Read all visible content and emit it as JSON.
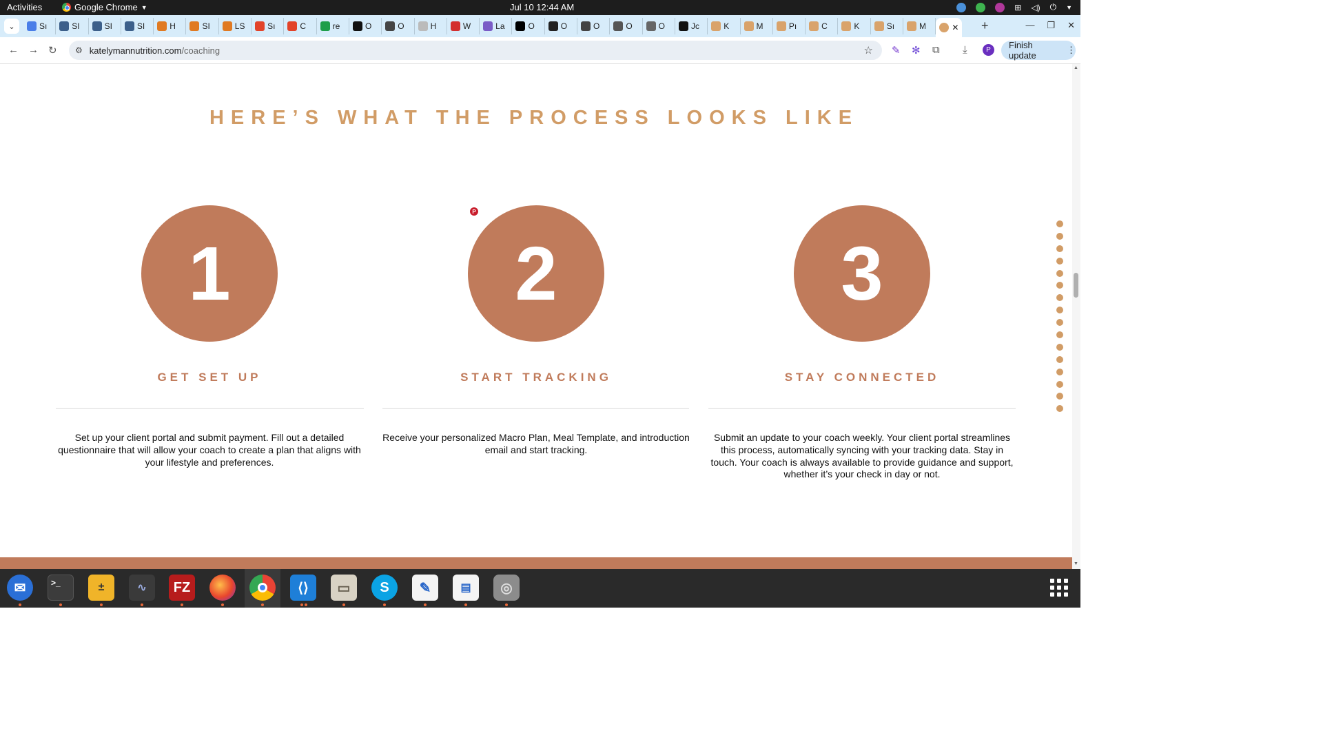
{
  "system_bar": {
    "activities": "Activities",
    "app_name": "Google Chrome",
    "clock": "Jul 10  12:44 AM"
  },
  "tabs": [
    {
      "label": "Sı",
      "color": "#4a7ee8"
    },
    {
      "label": "SI",
      "color": "#3c5f8a"
    },
    {
      "label": "SI",
      "color": "#3c5f8a"
    },
    {
      "label": "SI",
      "color": "#3c5f8a"
    },
    {
      "label": "H",
      "color": "#e07a22"
    },
    {
      "label": "SI",
      "color": "#e07a22"
    },
    {
      "label": "LS",
      "color": "#e07a22"
    },
    {
      "label": "Sı",
      "color": "#e24329"
    },
    {
      "label": "C",
      "color": "#e24329"
    },
    {
      "label": "re",
      "color": "#1e9e4a"
    },
    {
      "label": "O",
      "color": "#111111"
    },
    {
      "label": "O",
      "color": "#444444"
    },
    {
      "label": "H",
      "color": "#bbbbbb"
    },
    {
      "label": "W",
      "color": "#d32f2f"
    },
    {
      "label": "La",
      "color": "#7a5cc7"
    },
    {
      "label": "O",
      "color": "#000000"
    },
    {
      "label": "O",
      "color": "#222222"
    },
    {
      "label": "O",
      "color": "#444444"
    },
    {
      "label": "O",
      "color": "#555555"
    },
    {
      "label": "O",
      "color": "#666666"
    },
    {
      "label": "Jc",
      "color": "#111111"
    },
    {
      "label": "K",
      "color": "#d9a36b"
    },
    {
      "label": "M",
      "color": "#d9a36b"
    },
    {
      "label": "Pı",
      "color": "#d9a36b"
    },
    {
      "label": "C",
      "color": "#d9a36b"
    },
    {
      "label": "K",
      "color": "#d9a36b"
    },
    {
      "label": "Sı",
      "color": "#d9a36b"
    },
    {
      "label": "M",
      "color": "#d9a36b"
    }
  ],
  "active_tab": {
    "close": "✕",
    "color": "#d9a36b"
  },
  "address_bar": {
    "host": "katelymannutrition.com",
    "path": "/coaching",
    "profile_initial": "P",
    "finish_update": "Finish update"
  },
  "content": {
    "heading": "HERE’S WHAT THE PROCESS LOOKS LIKE",
    "steps": [
      {
        "number": "1",
        "title": "GET SET UP",
        "description": "Set up your client portal and submit payment. Fill out a detailed questionnaire that will allow your coach to create a plan that aligns with your lifestyle and preferences."
      },
      {
        "number": "2",
        "title": "START TRACKING",
        "description": "Receive your personalized Macro Plan, Meal Template, and introduction email and start tracking."
      },
      {
        "number": "3",
        "title": "STAY CONNECTED",
        "description": "Submit an update to your coach weekly. Your client portal streamlines this process, automatically syncing with your tracking data. Stay in touch. Your coach is always available to provide guidance and support, whether it’s your check in day or not."
      }
    ],
    "accent_color": "#c07b5b",
    "heading_color": "#d19c66"
  },
  "dock": {
    "apps": [
      "thunderbird-icon",
      "terminal-icon",
      "calculator-icon",
      "system-monitor-icon",
      "filezilla-icon",
      "firefox-icon",
      "chrome-icon",
      "vscode-icon",
      "files-icon",
      "skype-icon",
      "text-editor-icon",
      "document-viewer-icon",
      "disk-icon"
    ],
    "filezilla_label": "FZ",
    "skype_label": "S"
  }
}
